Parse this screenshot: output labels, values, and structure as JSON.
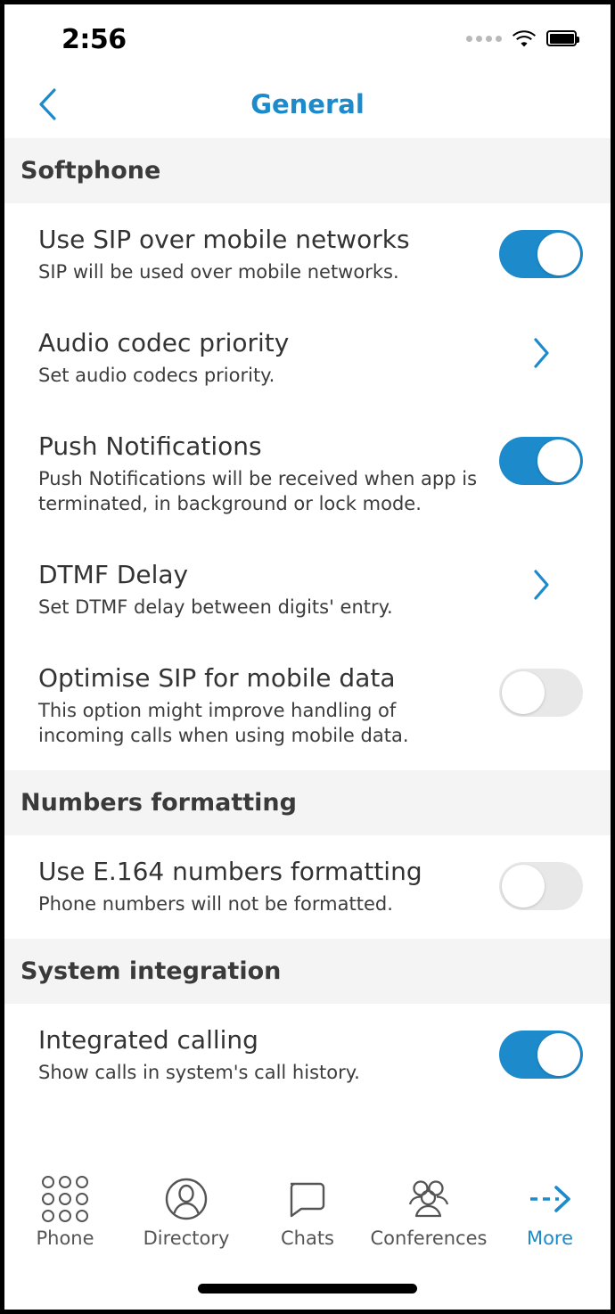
{
  "status_bar": {
    "time": "2:56",
    "signal_icon": "signal-dots-icon",
    "wifi_icon": "wifi-icon",
    "battery_icon": "battery-full-icon"
  },
  "nav": {
    "back_icon": "chevron-left-icon",
    "title": "General"
  },
  "colors": {
    "accent": "#1c8acb",
    "toggle_on": "#1c8acb",
    "toggle_off": "#e8e8e8",
    "section_header_bg": "#f4f4f4",
    "title_text": "#333333",
    "subtitle_text": "#3c3c3c"
  },
  "sections": [
    {
      "header": "Softphone",
      "rows": [
        {
          "title": "Use SIP over mobile networks",
          "subtitle": "SIP will be used over mobile networks.",
          "accessory": "toggle",
          "value": "on"
        },
        {
          "title": "Audio codec priority",
          "subtitle": "Set audio codecs priority.",
          "accessory": "chevron",
          "value": ""
        },
        {
          "title": "Push Notifications",
          "subtitle": "Push Notifications will be received when app is terminated, in background or lock mode.",
          "accessory": "toggle",
          "value": "on"
        },
        {
          "title": "DTMF Delay",
          "subtitle": "Set DTMF delay between digits' entry.",
          "accessory": "chevron",
          "value": ""
        },
        {
          "title": "Optimise SIP for mobile data",
          "subtitle": "This option might improve handling of incoming calls when using mobile data.",
          "accessory": "toggle",
          "value": "off"
        }
      ]
    },
    {
      "header": "Numbers formatting",
      "rows": [
        {
          "title": "Use E.164 numbers formatting",
          "subtitle": "Phone numbers will not be formatted.",
          "accessory": "toggle",
          "value": "off"
        }
      ]
    },
    {
      "header": "System integration",
      "rows": [
        {
          "title": "Integrated calling",
          "subtitle": "Show calls in system's call history.",
          "accessory": "toggle",
          "value": "on"
        }
      ]
    }
  ],
  "tabbar": {
    "items": [
      {
        "label": "Phone",
        "icon": "dialpad-icon",
        "active": false
      },
      {
        "label": "Directory",
        "icon": "contact-icon",
        "active": false
      },
      {
        "label": "Chats",
        "icon": "chat-bubble-icon",
        "active": false
      },
      {
        "label": "Conferences",
        "icon": "group-icon",
        "active": false
      },
      {
        "label": "More",
        "icon": "arrow-right-dashed-icon",
        "active": true
      }
    ]
  }
}
